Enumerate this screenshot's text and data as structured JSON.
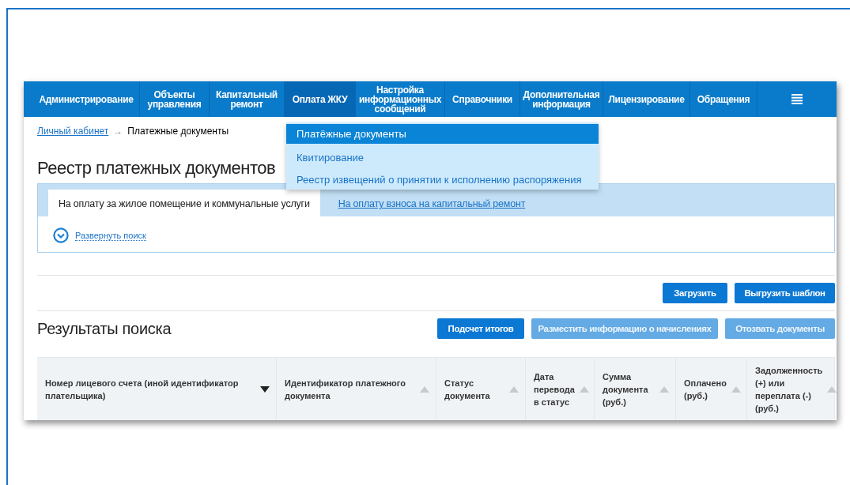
{
  "nav": {
    "items": [
      {
        "label": "Администрирование",
        "selected": false
      },
      {
        "label": "Объекты управления",
        "selected": false
      },
      {
        "label": "Капитальный ремонт",
        "selected": false
      },
      {
        "label": "Оплата ЖКУ",
        "selected": true
      },
      {
        "label": "Настройка информационных сообщений",
        "selected": false
      },
      {
        "label": "Справочники",
        "selected": false
      },
      {
        "label": "Дополнительная информация",
        "selected": false
      },
      {
        "label": "Лицензирование",
        "selected": false
      },
      {
        "label": "Обращения",
        "selected": false
      }
    ]
  },
  "dropdown": {
    "items": [
      {
        "label": "Платёжные документы",
        "selected": true
      },
      {
        "label": "Квитирование",
        "selected": false
      },
      {
        "label": "Реестр извещений о принятии к исполнению распоряжения",
        "selected": false
      }
    ]
  },
  "breadcrumb": {
    "link": "Личный кабинет",
    "separator": "→",
    "current": "Платежные документы"
  },
  "page_title": "Реестр платежных документов",
  "tabs": [
    {
      "label": "На оплату за жилое помещение и коммунальные услуги",
      "selected": true
    },
    {
      "label": "На оплату взноса на капитальный ремонт",
      "selected": false
    }
  ],
  "expand_search": "Развернуть поиск",
  "upload_buttons": [
    {
      "label": "Загрузить",
      "disabled": false
    },
    {
      "label": "Выгрузить шаблон",
      "disabled": false
    }
  ],
  "results": {
    "title": "Результаты поиска",
    "buttons": [
      {
        "label": "Подсчет итогов",
        "disabled": false
      },
      {
        "label": "Разместить информацию о начислениях",
        "disabled": true
      },
      {
        "label": "Отозвать документы",
        "disabled": true
      }
    ]
  },
  "table": {
    "columns": [
      {
        "label": "Номер лицевого счета (иной идентификатор плательщика)",
        "sorted": true
      },
      {
        "label": "Идентификатор платежного документа",
        "sorted": false
      },
      {
        "label": "Статус документа",
        "sorted": false
      },
      {
        "label": "Дата перевода в статус",
        "sorted": false
      },
      {
        "label": "Сумма документа (руб.)",
        "sorted": false
      },
      {
        "label": "Оплачено (руб.)",
        "sorted": false
      },
      {
        "label": "Задолженность (+) или переплата (-) (руб.)",
        "sorted": false
      }
    ]
  }
}
